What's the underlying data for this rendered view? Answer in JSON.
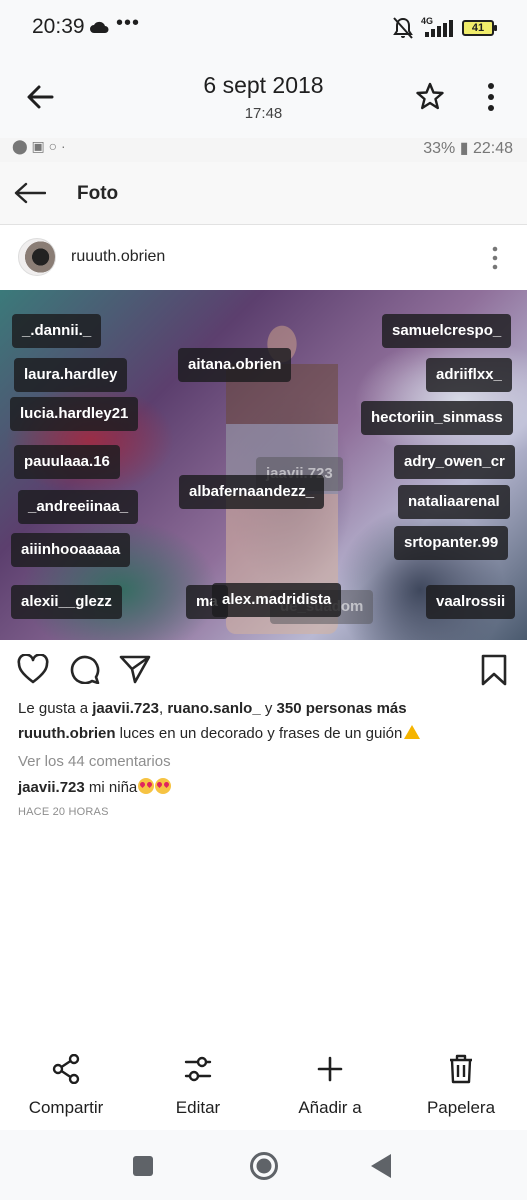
{
  "status": {
    "time": "20:39",
    "overflow": "•••",
    "network": "4G",
    "battery": "41"
  },
  "header": {
    "date": "6 sept 2018",
    "time": "17:48"
  },
  "inner": {
    "status_right": "33% ▮ 22:48",
    "screen_title": "Foto"
  },
  "post": {
    "username": "ruuuth.obrien",
    "likes_prefix": "Le gusta a ",
    "liker1": "jaavii.723",
    "liker_sep": ", ",
    "liker2": "ruano.sanlo_",
    "likes_and": " y ",
    "likes_more": "350 personas más",
    "caption_user": "ruuuth.obrien",
    "caption_text": " luces en un decorado y frases de un guión",
    "view_comments": "Ver los 44 comentarios",
    "comment_user": "jaavii.723",
    "comment_text": " mi niña",
    "time_ago": "HACE 20 HORAS",
    "tags": [
      "_.dannii._",
      "samuelcrespo_",
      "aitana.obrien",
      "laura.hardley",
      "adriiflxx_",
      "lucia.hardley21",
      "hectoriin_sinmass",
      "jaavii.723",
      "pauulaaa.16",
      "adry_owen_cr",
      "albafernaandezz_",
      "nataliaarenal",
      "_andreeiinaa_",
      "srtopanter.99",
      "aiiinhooaaaaa",
      "alexii__glezz",
      "ma",
      "alex.madridista",
      "ue_suadom",
      "vaalrossii"
    ]
  },
  "bottom_actions": {
    "share": "Compartir",
    "edit": "Editar",
    "add": "Añadir a",
    "trash": "Papelera"
  },
  "colors": {
    "bar_bg": "#f8f9fa",
    "tag_bg": "#1c1c1e",
    "battery": "#f0ec6a"
  }
}
